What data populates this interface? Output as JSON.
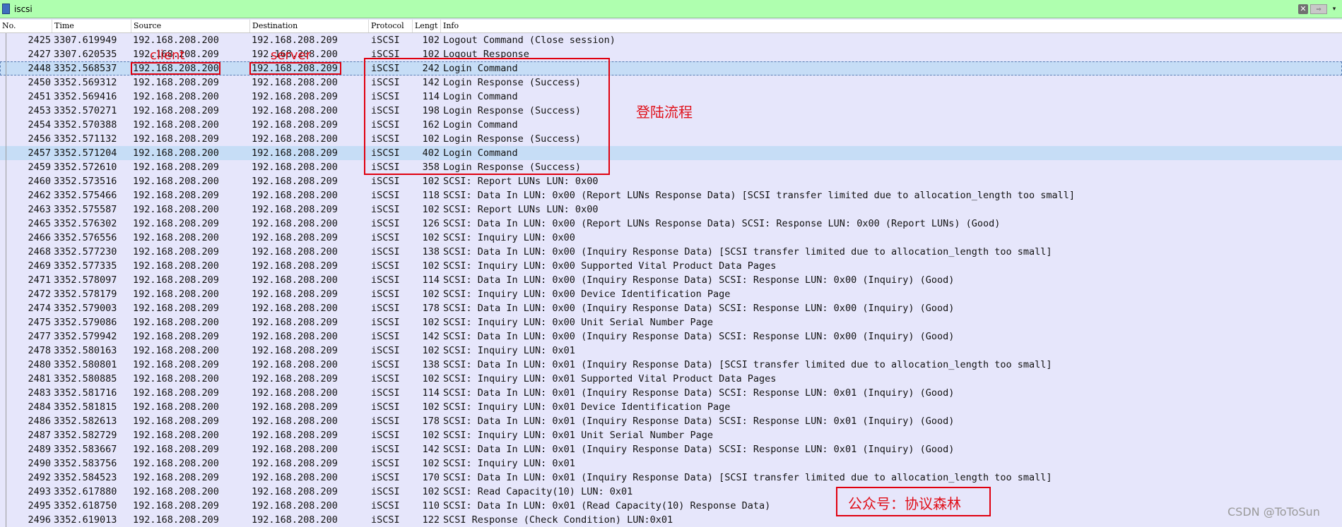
{
  "filter": {
    "value": "iscsi",
    "clear_glyph": "✕",
    "apply_glyph": "⇨",
    "dropdown_glyph": "▾"
  },
  "columns": {
    "no": "No.",
    "time": "Time",
    "source": "Source",
    "destination": "Destination",
    "protocol": "Protocol",
    "length": "Lengt",
    "info": "Info"
  },
  "packets": [
    {
      "no": "2425",
      "time": "3307.619949",
      "source": "192.168.208.200",
      "destination": "192.168.208.209",
      "protocol": "iSCSI",
      "length": "102",
      "info": "Logout Command (Close session)"
    },
    {
      "no": "2427",
      "time": "3307.620535",
      "source": "192.168.208.209",
      "destination": "192.168.208.200",
      "protocol": "iSCSI",
      "length": "102",
      "info": "Logout Response"
    },
    {
      "no": "2448",
      "time": "3352.568537",
      "source": "192.168.208.200",
      "destination": "192.168.208.209",
      "protocol": "iSCSI",
      "length": "242",
      "info": "Login Command"
    },
    {
      "no": "2450",
      "time": "3352.569312",
      "source": "192.168.208.209",
      "destination": "192.168.208.200",
      "protocol": "iSCSI",
      "length": "142",
      "info": "Login Response (Success)"
    },
    {
      "no": "2451",
      "time": "3352.569416",
      "source": "192.168.208.200",
      "destination": "192.168.208.209",
      "protocol": "iSCSI",
      "length": "114",
      "info": "Login Command"
    },
    {
      "no": "2453",
      "time": "3352.570271",
      "source": "192.168.208.209",
      "destination": "192.168.208.200",
      "protocol": "iSCSI",
      "length": "198",
      "info": "Login Response (Success)"
    },
    {
      "no": "2454",
      "time": "3352.570388",
      "source": "192.168.208.200",
      "destination": "192.168.208.209",
      "protocol": "iSCSI",
      "length": "162",
      "info": "Login Command"
    },
    {
      "no": "2456",
      "time": "3352.571132",
      "source": "192.168.208.209",
      "destination": "192.168.208.200",
      "protocol": "iSCSI",
      "length": "102",
      "info": "Login Response (Success)"
    },
    {
      "no": "2457",
      "time": "3352.571204",
      "source": "192.168.208.200",
      "destination": "192.168.208.209",
      "protocol": "iSCSI",
      "length": "402",
      "info": "Login Command"
    },
    {
      "no": "2459",
      "time": "3352.572610",
      "source": "192.168.208.209",
      "destination": "192.168.208.200",
      "protocol": "iSCSI",
      "length": "358",
      "info": "Login Response (Success)"
    },
    {
      "no": "2460",
      "time": "3352.573516",
      "source": "192.168.208.200",
      "destination": "192.168.208.209",
      "protocol": "iSCSI",
      "length": "102",
      "info": "SCSI: Report LUNs LUN: 0x00"
    },
    {
      "no": "2462",
      "time": "3352.575466",
      "source": "192.168.208.209",
      "destination": "192.168.208.200",
      "protocol": "iSCSI",
      "length": "118",
      "info": "SCSI: Data In LUN: 0x00 (Report LUNs Response Data) [SCSI transfer limited due to allocation_length too small]"
    },
    {
      "no": "2463",
      "time": "3352.575587",
      "source": "192.168.208.200",
      "destination": "192.168.208.209",
      "protocol": "iSCSI",
      "length": "102",
      "info": "SCSI: Report LUNs LUN: 0x00"
    },
    {
      "no": "2465",
      "time": "3352.576302",
      "source": "192.168.208.209",
      "destination": "192.168.208.200",
      "protocol": "iSCSI",
      "length": "126",
      "info": "SCSI: Data In LUN: 0x00 (Report LUNs Response Data) SCSI: Response LUN: 0x00 (Report LUNs) (Good)"
    },
    {
      "no": "2466",
      "time": "3352.576556",
      "source": "192.168.208.200",
      "destination": "192.168.208.209",
      "protocol": "iSCSI",
      "length": "102",
      "info": "SCSI: Inquiry LUN: 0x00"
    },
    {
      "no": "2468",
      "time": "3352.577230",
      "source": "192.168.208.209",
      "destination": "192.168.208.200",
      "protocol": "iSCSI",
      "length": "138",
      "info": "SCSI: Data In LUN: 0x00 (Inquiry Response Data) [SCSI transfer limited due to allocation_length too small]"
    },
    {
      "no": "2469",
      "time": "3352.577335",
      "source": "192.168.208.200",
      "destination": "192.168.208.209",
      "protocol": "iSCSI",
      "length": "102",
      "info": "SCSI: Inquiry LUN: 0x00  Supported Vital Product Data Pages"
    },
    {
      "no": "2471",
      "time": "3352.578097",
      "source": "192.168.208.209",
      "destination": "192.168.208.200",
      "protocol": "iSCSI",
      "length": "114",
      "info": "SCSI: Data In LUN: 0x00 (Inquiry Response Data) SCSI: Response LUN: 0x00 (Inquiry) (Good)"
    },
    {
      "no": "2472",
      "time": "3352.578179",
      "source": "192.168.208.200",
      "destination": "192.168.208.209",
      "protocol": "iSCSI",
      "length": "102",
      "info": "SCSI: Inquiry LUN: 0x00  Device Identification Page"
    },
    {
      "no": "2474",
      "time": "3352.579003",
      "source": "192.168.208.209",
      "destination": "192.168.208.200",
      "protocol": "iSCSI",
      "length": "178",
      "info": "SCSI: Data In LUN: 0x00 (Inquiry Response Data) SCSI: Response LUN: 0x00 (Inquiry) (Good)"
    },
    {
      "no": "2475",
      "time": "3352.579086",
      "source": "192.168.208.200",
      "destination": "192.168.208.209",
      "protocol": "iSCSI",
      "length": "102",
      "info": "SCSI: Inquiry LUN: 0x00  Unit Serial Number Page"
    },
    {
      "no": "2477",
      "time": "3352.579942",
      "source": "192.168.208.209",
      "destination": "192.168.208.200",
      "protocol": "iSCSI",
      "length": "142",
      "info": "SCSI: Data In LUN: 0x00 (Inquiry Response Data) SCSI: Response LUN: 0x00 (Inquiry) (Good)"
    },
    {
      "no": "2478",
      "time": "3352.580163",
      "source": "192.168.208.200",
      "destination": "192.168.208.209",
      "protocol": "iSCSI",
      "length": "102",
      "info": "SCSI: Inquiry LUN: 0x01"
    },
    {
      "no": "2480",
      "time": "3352.580801",
      "source": "192.168.208.209",
      "destination": "192.168.208.200",
      "protocol": "iSCSI",
      "length": "138",
      "info": "SCSI: Data In LUN: 0x01 (Inquiry Response Data) [SCSI transfer limited due to allocation_length too small]"
    },
    {
      "no": "2481",
      "time": "3352.580885",
      "source": "192.168.208.200",
      "destination": "192.168.208.209",
      "protocol": "iSCSI",
      "length": "102",
      "info": "SCSI: Inquiry LUN: 0x01  Supported Vital Product Data Pages"
    },
    {
      "no": "2483",
      "time": "3352.581716",
      "source": "192.168.208.209",
      "destination": "192.168.208.200",
      "protocol": "iSCSI",
      "length": "114",
      "info": "SCSI: Data In LUN: 0x01 (Inquiry Response Data) SCSI: Response LUN: 0x01 (Inquiry) (Good)"
    },
    {
      "no": "2484",
      "time": "3352.581815",
      "source": "192.168.208.200",
      "destination": "192.168.208.209",
      "protocol": "iSCSI",
      "length": "102",
      "info": "SCSI: Inquiry LUN: 0x01  Device Identification Page"
    },
    {
      "no": "2486",
      "time": "3352.582613",
      "source": "192.168.208.209",
      "destination": "192.168.208.200",
      "protocol": "iSCSI",
      "length": "178",
      "info": "SCSI: Data In LUN: 0x01 (Inquiry Response Data) SCSI: Response LUN: 0x01 (Inquiry) (Good)"
    },
    {
      "no": "2487",
      "time": "3352.582729",
      "source": "192.168.208.200",
      "destination": "192.168.208.209",
      "protocol": "iSCSI",
      "length": "102",
      "info": "SCSI: Inquiry LUN: 0x01  Unit Serial Number Page"
    },
    {
      "no": "2489",
      "time": "3352.583667",
      "source": "192.168.208.209",
      "destination": "192.168.208.200",
      "protocol": "iSCSI",
      "length": "142",
      "info": "SCSI: Data In LUN: 0x01 (Inquiry Response Data) SCSI: Response LUN: 0x01 (Inquiry) (Good)"
    },
    {
      "no": "2490",
      "time": "3352.583756",
      "source": "192.168.208.200",
      "destination": "192.168.208.209",
      "protocol": "iSCSI",
      "length": "102",
      "info": "SCSI: Inquiry LUN: 0x01"
    },
    {
      "no": "2492",
      "time": "3352.584523",
      "source": "192.168.208.209",
      "destination": "192.168.208.200",
      "protocol": "iSCSI",
      "length": "170",
      "info": "SCSI: Data In LUN: 0x01 (Inquiry Response Data) [SCSI transfer limited due to allocation_length too small]"
    },
    {
      "no": "2493",
      "time": "3352.617880",
      "source": "192.168.208.200",
      "destination": "192.168.208.209",
      "protocol": "iSCSI",
      "length": "102",
      "info": "SCSI: Read Capacity(10) LUN: 0x01"
    },
    {
      "no": "2495",
      "time": "3352.618750",
      "source": "192.168.208.209",
      "destination": "192.168.208.200",
      "protocol": "iSCSI",
      "length": "110",
      "info": "SCSI: Data In LUN: 0x01 (Read Capacity(10) Response Data)"
    },
    {
      "no": "2496",
      "time": "3352.619013",
      "source": "192.168.208.209",
      "destination": "192.168.208.200",
      "protocol": "iSCSI",
      "length": "122",
      "info": "SCSI Response (Check Condition) LUN:0x01"
    }
  ],
  "selection": {
    "focused_row": "2448",
    "highlighted_row": "2457",
    "highlight_color": "#c6ddf6"
  },
  "annotations": {
    "client_label": "client",
    "server_label": "server",
    "login_flow_label": "登陆流程",
    "account_label": "公众号：协议森林",
    "color": "#e0000f"
  },
  "watermark": "CSDN @ToToSun"
}
